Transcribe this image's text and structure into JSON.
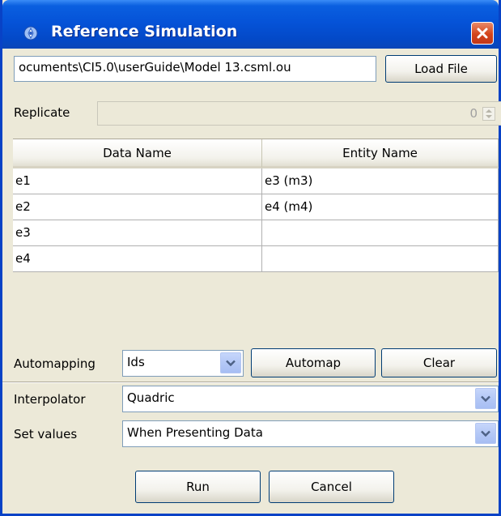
{
  "window": {
    "title": "Reference Simulation",
    "icon": "app-icon",
    "close_icon": "close-icon"
  },
  "file": {
    "path_value": "ocuments\\CI5.0\\userGuide\\Model 13.csml.ou",
    "load_button": "Load File"
  },
  "replicate": {
    "label": "Replicate",
    "value": "0"
  },
  "table": {
    "columns": [
      "Data Name",
      "Entity Name"
    ],
    "rows": [
      [
        "e1",
        "e3 (m3)"
      ],
      [
        "e2",
        "e4 (m4)"
      ],
      [
        "e3",
        ""
      ],
      [
        "e4",
        ""
      ]
    ]
  },
  "automapping": {
    "label": "Automapping",
    "selected": "Ids",
    "automap_button": "Automap",
    "clear_button": "Clear"
  },
  "interpolator": {
    "label": "Interpolator",
    "selected": "Quadric"
  },
  "set_values": {
    "label": "Set values",
    "selected": "When Presenting Data"
  },
  "actions": {
    "run_button": "Run",
    "cancel_button": "Cancel"
  },
  "colors": {
    "title_bar": "#0553D8",
    "window_border": "#0842C6",
    "close_button": "#D4441B",
    "dialog_background": "#ECE9D8"
  }
}
